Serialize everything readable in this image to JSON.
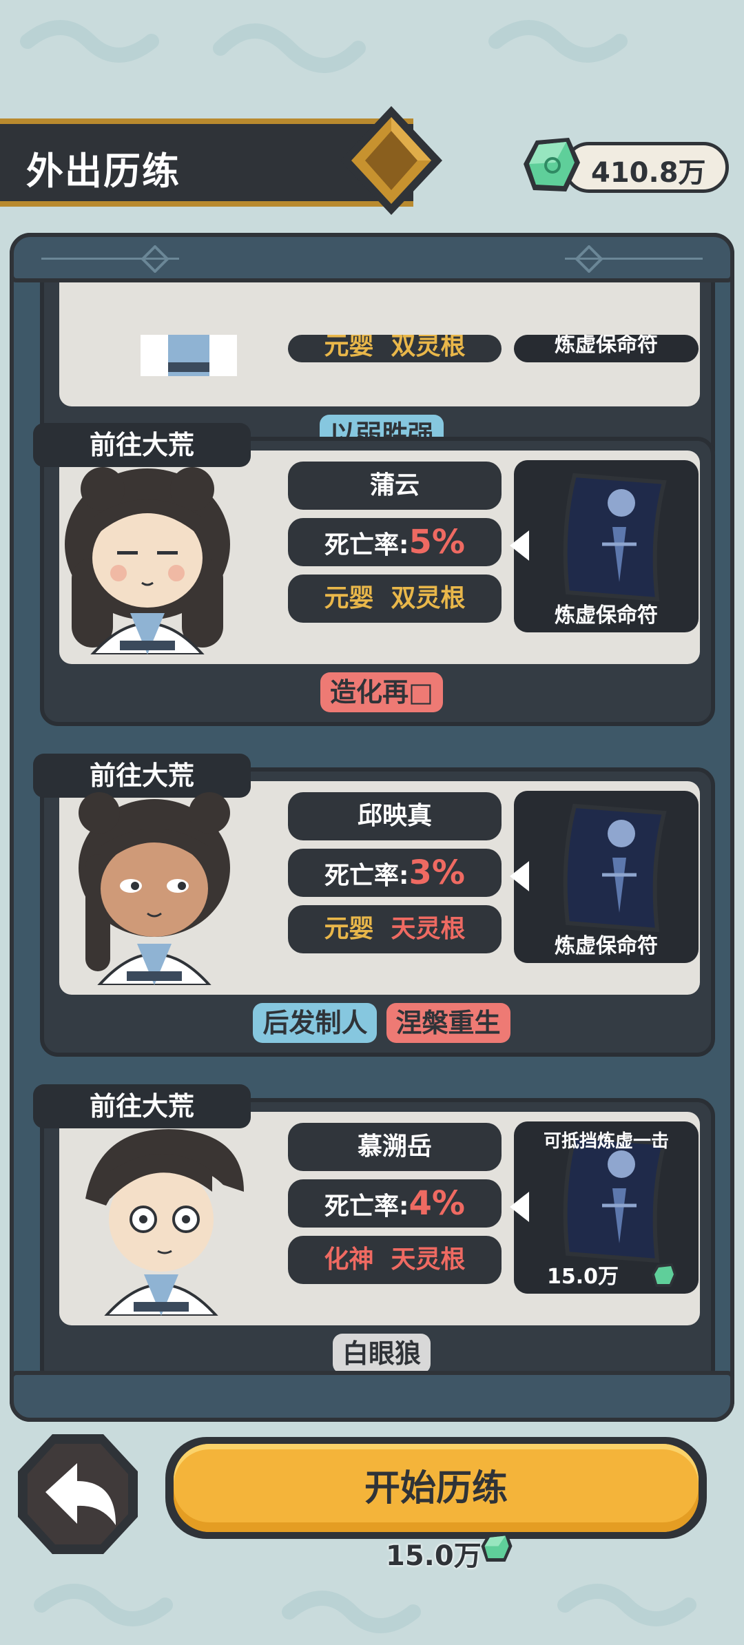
{
  "header": {
    "title": "外出历练"
  },
  "currency": {
    "value": "410.8万",
    "icon": "jade-gem-icon"
  },
  "first_card_partial": {
    "realm": "元婴",
    "root": "双灵根",
    "item": "炼虚保命符",
    "tags": [
      "以弱胜强"
    ]
  },
  "cards": [
    {
      "destination": "前往大荒",
      "name": "蒲云",
      "death_label": "死亡率:",
      "death_rate": "5%",
      "realm": "元婴",
      "root": "双灵根",
      "item": "炼虚保命符",
      "tags": [
        "造化再□"
      ]
    },
    {
      "destination": "前往大荒",
      "name": "邱映真",
      "death_label": "死亡率:",
      "death_rate": "3%",
      "realm": "元婴",
      "root": "天灵根",
      "item": "炼虚保命符",
      "tags": [
        "后发制人",
        "涅槃重生"
      ]
    },
    {
      "destination": "前往大荒",
      "name": "慕溯岳",
      "death_label": "死亡率:",
      "death_rate": "4%",
      "realm": "化神",
      "root": "天灵根",
      "item_desc": "可抵挡炼虚一击",
      "item_price": "15.0万",
      "tags": [
        "白眼狼"
      ]
    }
  ],
  "footer": {
    "start_label": "开始历练",
    "cost": "15.0万"
  },
  "colors": {
    "accent_red": "#ef6a62",
    "gold": "#e9b74a",
    "tag_blue": "#86c7df",
    "tag_red": "#ee7a74",
    "tag_gray": "#d8d8d8",
    "button": "#f4b43a"
  }
}
